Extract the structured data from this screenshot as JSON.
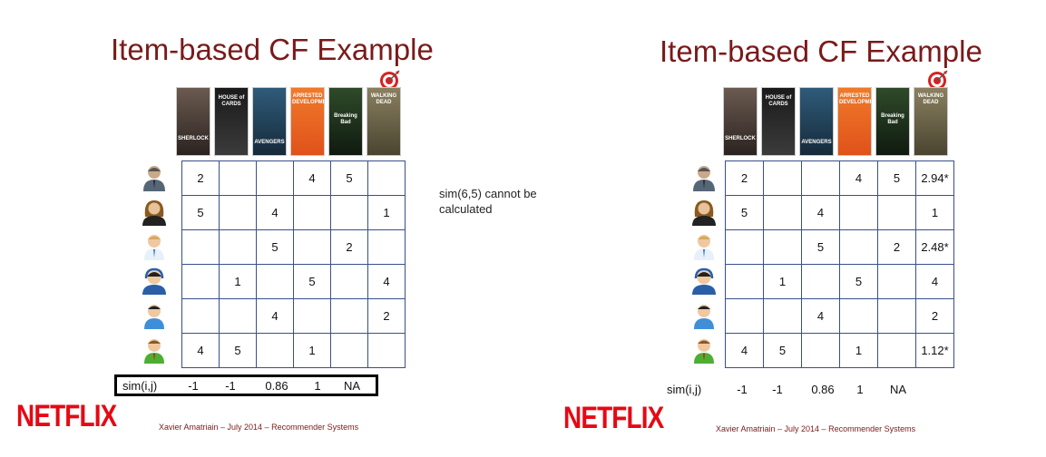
{
  "left": {
    "title": "Item-based CF Example",
    "posters": [
      "SHERLOCK",
      "HOUSE of CARDS",
      "AVENGERS",
      "ARRESTED DEVELOPMENT",
      "Breaking Bad",
      "WALKING DEAD"
    ],
    "ratings": [
      [
        "2",
        "",
        "",
        "4",
        "5",
        ""
      ],
      [
        "5",
        "",
        "4",
        "",
        "",
        "1"
      ],
      [
        "",
        "",
        "5",
        "",
        "2",
        ""
      ],
      [
        "",
        "1",
        "",
        "5",
        "",
        "4"
      ],
      [
        "",
        "",
        "4",
        "",
        "",
        "2"
      ],
      [
        "4",
        "5",
        "",
        "1",
        "",
        ""
      ]
    ],
    "sim_label": "sim(i,j)",
    "sim_values": [
      "-1",
      "-1",
      "0.86",
      "1",
      "NA"
    ],
    "note": "sim(6,5) cannot be calculated",
    "logo": "NETFLIX",
    "footer": "Xavier Amatriain – July 2014 – Recommender Systems"
  },
  "right": {
    "title": "Item-based CF Example",
    "posters": [
      "SHERLOCK",
      "HOUSE of CARDS",
      "AVENGERS",
      "ARRESTED DEVELOPMENT",
      "Breaking Bad",
      "WALKING DEAD"
    ],
    "ratings": [
      [
        "2",
        "",
        "",
        "4",
        "5",
        "2.94*"
      ],
      [
        "5",
        "",
        "4",
        "",
        "",
        "1"
      ],
      [
        "",
        "",
        "5",
        "",
        "2",
        "2.48*"
      ],
      [
        "",
        "1",
        "",
        "5",
        "",
        "4"
      ],
      [
        "",
        "",
        "4",
        "",
        "",
        "2"
      ],
      [
        "4",
        "5",
        "",
        "1",
        "",
        "1.12*"
      ]
    ],
    "sim_label": "sim(i,j)",
    "sim_values": [
      "-1",
      "-1",
      "0.86",
      "1",
      "NA"
    ],
    "logo": "NETFLIX",
    "footer": "Xavier Amatriain – July 2014 – Recommender Systems"
  },
  "icons": {
    "target": "target-icon",
    "users": [
      "user-suit-icon",
      "user-woman-icon",
      "user-man-icon",
      "user-headset-icon",
      "user-person-icon",
      "user-green-icon"
    ]
  },
  "colors": {
    "title": "#7a1a1a",
    "netflix": "#e50914",
    "table_border": "#3a4f8c"
  }
}
